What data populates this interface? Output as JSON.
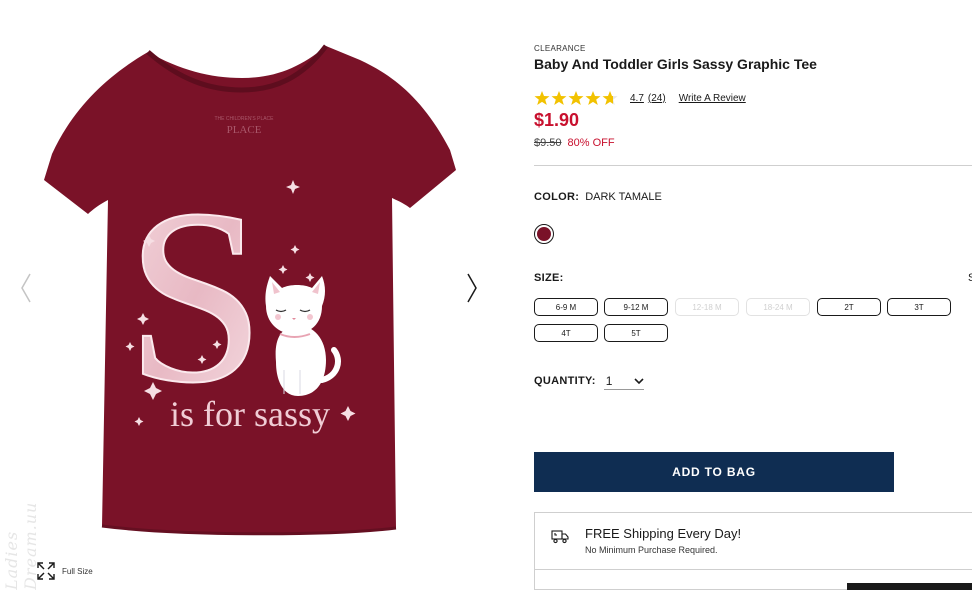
{
  "gallery": {
    "fullsize_label": "Full Size",
    "shirt_brand_text": "THE CHILDREN'S PLACE",
    "shirt_graphic_letter": "S",
    "shirt_graphic_text": "is for sassy",
    "watermark": "Ladies Dream.uu"
  },
  "product": {
    "eyebrow": "CLEARANCE",
    "title": "Baby And Toddler Girls Sassy Graphic Tee",
    "rating_value": "4.7",
    "rating_count": "(24)",
    "star_level": 4.7,
    "write_review": "Write A Review",
    "price": "$1.90",
    "old_price": "$9.50",
    "discount": "80% OFF",
    "color_label": "COLOR:",
    "color_value": "DARK TAMALE",
    "size_label": "SIZE:",
    "sizes": [
      {
        "label": "6-9 M",
        "available": true
      },
      {
        "label": "9-12 M",
        "available": true
      },
      {
        "label": "12-18 M",
        "available": false
      },
      {
        "label": "18-24 M",
        "available": false
      },
      {
        "label": "2T",
        "available": true
      },
      {
        "label": "3T",
        "available": true
      },
      {
        "label": "4T",
        "available": true
      },
      {
        "label": "5T",
        "available": true
      }
    ],
    "quantity_label": "QUANTITY:",
    "quantity_value": "1",
    "add_to_bag": "ADD TO BAG",
    "shipping_title": "FREE Shipping Every Day!",
    "shipping_sub": "No Minimum Purchase Required."
  },
  "colors": {
    "shirt": "#7a1228",
    "price_red": "#c8102e",
    "button_navy": "#0f2d52",
    "star_gold": "#f2c200"
  }
}
